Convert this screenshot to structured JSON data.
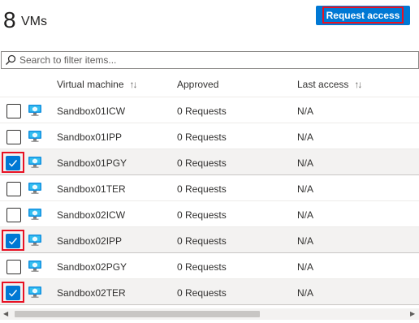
{
  "header": {
    "count": "8",
    "count_unit": "VMs",
    "request_button_label": "Request access"
  },
  "search": {
    "placeholder": "Search to filter items...",
    "value": ""
  },
  "columns": {
    "vm": "Virtual machine",
    "approved": "Approved",
    "last_access": "Last access",
    "sort_glyph": "↑↓"
  },
  "rows": [
    {
      "name": "Sandbox01ICW",
      "approved": "0 Requests",
      "last_access": "N/A",
      "checked": false
    },
    {
      "name": "Sandbox01IPP",
      "approved": "0 Requests",
      "last_access": "N/A",
      "checked": false
    },
    {
      "name": "Sandbox01PGY",
      "approved": "0 Requests",
      "last_access": "N/A",
      "checked": true
    },
    {
      "name": "Sandbox01TER",
      "approved": "0 Requests",
      "last_access": "N/A",
      "checked": false
    },
    {
      "name": "Sandbox02ICW",
      "approved": "0 Requests",
      "last_access": "N/A",
      "checked": false
    },
    {
      "name": "Sandbox02IPP",
      "approved": "0 Requests",
      "last_access": "N/A",
      "checked": true
    },
    {
      "name": "Sandbox02PGY",
      "approved": "0 Requests",
      "last_access": "N/A",
      "checked": false
    },
    {
      "name": "Sandbox02TER",
      "approved": "0 Requests",
      "last_access": "N/A",
      "checked": true
    }
  ],
  "colors": {
    "accent": "#0078d4",
    "highlight": "#e81123",
    "selected_row": "#f3f2f1"
  },
  "icons": {
    "search": "search-icon",
    "vm": "virtual-machine-icon",
    "check": "checkmark-icon",
    "sort": "sort-icon"
  }
}
